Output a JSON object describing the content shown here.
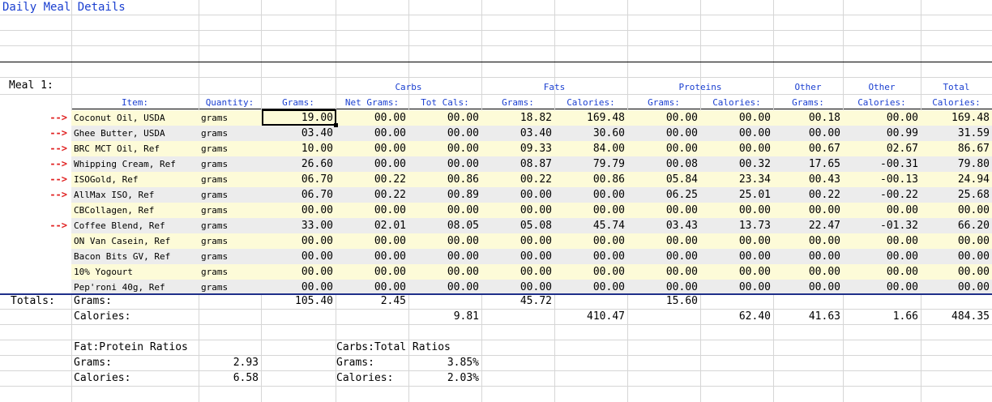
{
  "sheet": {
    "title": "Daily Meal Details",
    "meal_label": "Meal 1:",
    "groups": [
      "Carbs",
      "Fats",
      "Proteins",
      "Other",
      "Other",
      "Total"
    ],
    "headers": [
      "Item:",
      "Quantity:",
      "Grams:",
      "Net Grams:",
      "Tot Cals:",
      "Grams:",
      "Calories:",
      "Grams:",
      "Calories:",
      "Grams:",
      "Calories:",
      "Calories:"
    ],
    "arrow": "-->",
    "rows": [
      {
        "arrow": true,
        "item": "Coconut Oil, USDA",
        "qty": "grams",
        "vals": [
          "19.00",
          "00.00",
          "00.00",
          "18.82",
          "169.48",
          "00.00",
          "00.00",
          "00.18",
          "00.00",
          "169.48"
        ]
      },
      {
        "arrow": true,
        "item": "Ghee Butter, USDA",
        "qty": "grams",
        "vals": [
          "03.40",
          "00.00",
          "00.00",
          "03.40",
          "30.60",
          "00.00",
          "00.00",
          "00.00",
          "00.99",
          "31.59"
        ]
      },
      {
        "arrow": true,
        "item": "BRC MCT Oil, Ref",
        "qty": "grams",
        "vals": [
          "10.00",
          "00.00",
          "00.00",
          "09.33",
          "84.00",
          "00.00",
          "00.00",
          "00.67",
          "02.67",
          "86.67"
        ]
      },
      {
        "arrow": true,
        "item": "Whipping Cream, Ref",
        "qty": "grams",
        "vals": [
          "26.60",
          "00.00",
          "00.00",
          "08.87",
          "79.79",
          "00.08",
          "00.32",
          "17.65",
          "-00.31",
          "79.80"
        ]
      },
      {
        "arrow": true,
        "item": "ISOGold, Ref",
        "qty": "grams",
        "vals": [
          "06.70",
          "00.22",
          "00.86",
          "00.22",
          "00.86",
          "05.84",
          "23.34",
          "00.43",
          "-00.13",
          "24.94"
        ]
      },
      {
        "arrow": true,
        "item": "AllMax ISO, Ref",
        "qty": "grams",
        "vals": [
          "06.70",
          "00.22",
          "00.89",
          "00.00",
          "00.00",
          "06.25",
          "25.01",
          "00.22",
          "-00.22",
          "25.68"
        ]
      },
      {
        "arrow": false,
        "item": "CBCollagen, Ref",
        "qty": "grams",
        "vals": [
          "00.00",
          "00.00",
          "00.00",
          "00.00",
          "00.00",
          "00.00",
          "00.00",
          "00.00",
          "00.00",
          "00.00"
        ]
      },
      {
        "arrow": true,
        "item": "Coffee Blend, Ref",
        "qty": "grams",
        "vals": [
          "33.00",
          "02.01",
          "08.05",
          "05.08",
          "45.74",
          "03.43",
          "13.73",
          "22.47",
          "-01.32",
          "66.20"
        ]
      },
      {
        "arrow": false,
        "item": "ON Van Casein, Ref",
        "qty": "grams",
        "vals": [
          "00.00",
          "00.00",
          "00.00",
          "00.00",
          "00.00",
          "00.00",
          "00.00",
          "00.00",
          "00.00",
          "00.00"
        ]
      },
      {
        "arrow": false,
        "item": "Bacon Bits GV, Ref",
        "qty": "grams",
        "vals": [
          "00.00",
          "00.00",
          "00.00",
          "00.00",
          "00.00",
          "00.00",
          "00.00",
          "00.00",
          "00.00",
          "00.00"
        ]
      },
      {
        "arrow": false,
        "item": "10% Yogourt",
        "qty": "grams",
        "vals": [
          "00.00",
          "00.00",
          "00.00",
          "00.00",
          "00.00",
          "00.00",
          "00.00",
          "00.00",
          "00.00",
          "00.00"
        ]
      },
      {
        "arrow": false,
        "item": "Pep'roni 40g, Ref",
        "qty": "grams",
        "vals": [
          "00.00",
          "00.00",
          "00.00",
          "00.00",
          "00.00",
          "00.00",
          "00.00",
          "00.00",
          "00.00",
          "00.00"
        ]
      }
    ],
    "totals": {
      "label": "Totals:",
      "grams_label": "Grams:",
      "calories_label": "Calories:",
      "grams": {
        "grams": "105.40",
        "net_grams": "2.45",
        "fats_grams": "45.72",
        "proteins_grams": "15.60"
      },
      "calories": {
        "carbs_cals": "9.81",
        "fats_cals": "410.47",
        "proteins_cals": "62.40",
        "other_grams": "41.63",
        "other_cals": "1.66",
        "total_cals": "484.35"
      }
    },
    "fat_protein": {
      "title": "Fat:Protein Ratios",
      "grams_label": "Grams:",
      "grams": "2.93",
      "calories_label": "Calories:",
      "calories": "6.58"
    },
    "carbs_total": {
      "title": "Carbs:Total Ratios",
      "grams_label": "Grams:",
      "grams": "3.85%",
      "calories_label": "Calories:",
      "calories": "2.03%"
    },
    "colors": {
      "accent": "#1a3fd0",
      "arrow": "#e02020",
      "band_yellow": "#fdfbd8",
      "band_gray": "#ececec",
      "rule": "#1f2f8a"
    }
  }
}
